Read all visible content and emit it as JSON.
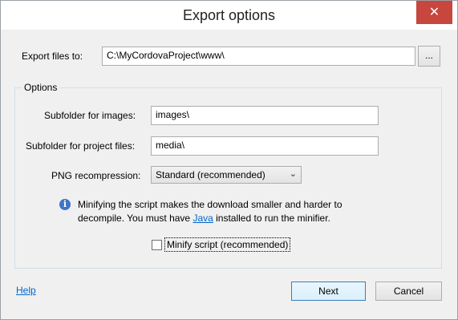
{
  "window": {
    "title": "Export options",
    "close_glyph": "✕"
  },
  "export": {
    "label": "Export files to:",
    "path": "C:\\MyCordovaProject\\www\\",
    "browse_label": "..."
  },
  "options": {
    "group_title": "Options",
    "images_label": "Subfolder for images:",
    "images_value": "images\\",
    "project_label": "Subfolder for project files:",
    "project_value": "media\\",
    "png_label": "PNG recompression:",
    "png_value": "Standard (recommended)",
    "info_line1": "Minifying the script makes the download smaller and harder to",
    "info_line2_a": "decompile.  You must have ",
    "info_link": "Java",
    "info_line2_b": " installed to run the minifier.",
    "minify_label": "Minify script (recommended)",
    "minify_checked": false
  },
  "footer": {
    "help_label": "Help",
    "next_label": "Next",
    "cancel_label": "Cancel"
  },
  "icons": {
    "info": "info-icon",
    "close": "close-icon",
    "dropdown": "chevron-down-icon"
  }
}
